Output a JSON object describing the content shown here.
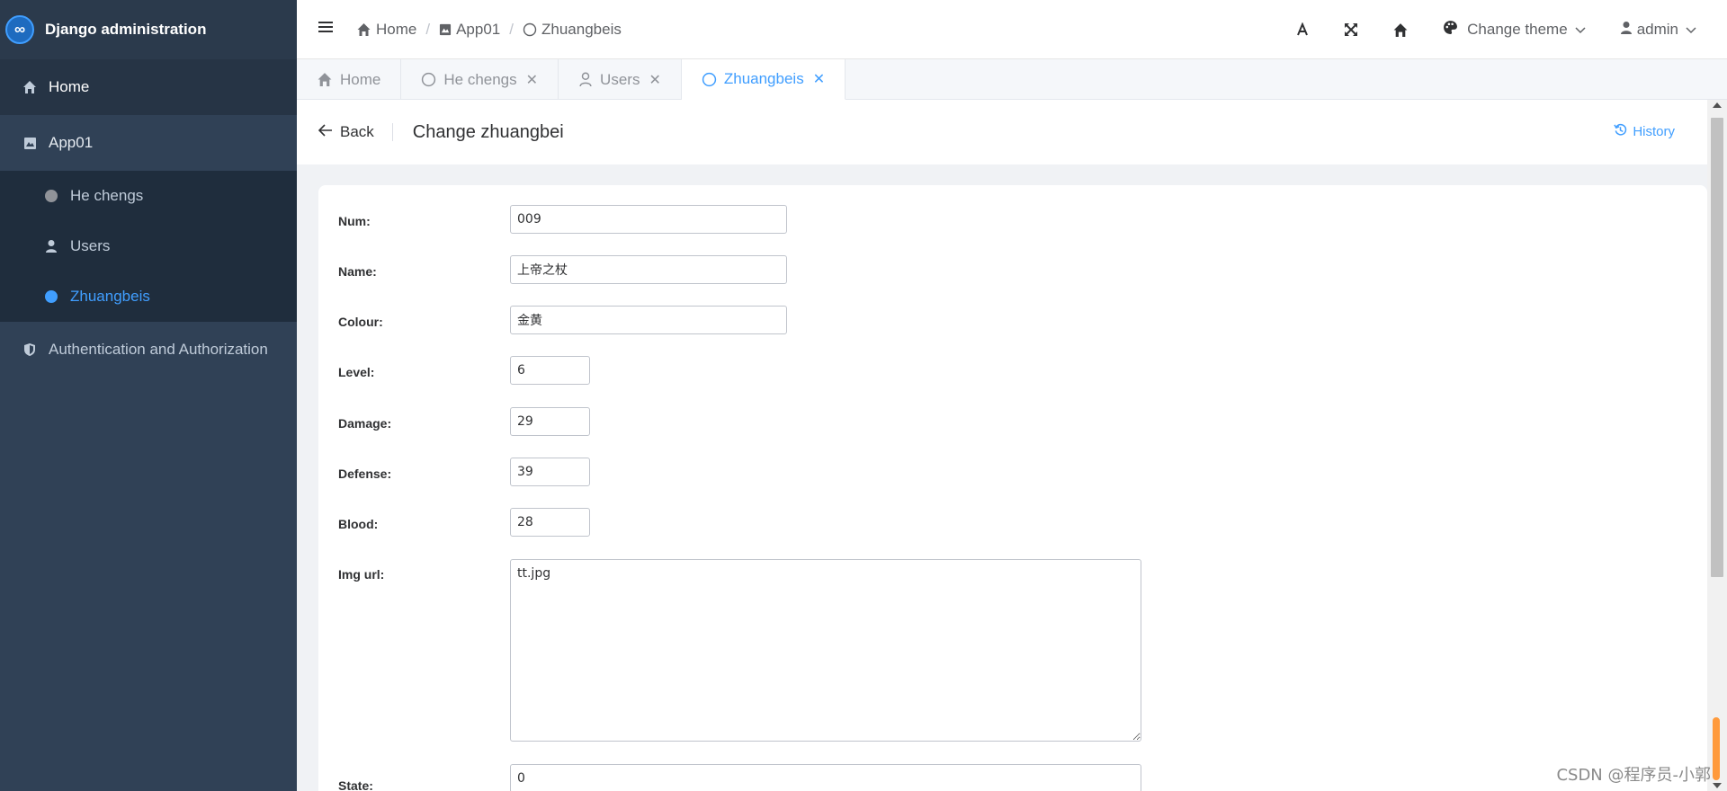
{
  "brand": {
    "title": "Django administration",
    "logo_glyph": "∞"
  },
  "sidebar": {
    "home": "Home",
    "app": "App01",
    "items": [
      {
        "label": "He chengs"
      },
      {
        "label": "Users"
      },
      {
        "label": "Zhuangbeis"
      }
    ],
    "auth": "Authentication and Authorization"
  },
  "header": {
    "breadcrumb": {
      "home": "Home",
      "app": "App01",
      "current": "Zhuangbeis"
    },
    "change_theme": "Change theme",
    "user": "admin"
  },
  "tabs": [
    {
      "label": "Home"
    },
    {
      "label": "He chengs"
    },
    {
      "label": "Users"
    },
    {
      "label": "Zhuangbeis"
    }
  ],
  "page": {
    "back": "Back",
    "title": "Change zhuangbei",
    "history": "History"
  },
  "form": {
    "num": {
      "label": "Num:",
      "value": "009"
    },
    "name": {
      "label": "Name:",
      "value": "上帝之杖"
    },
    "colour": {
      "label": "Colour:",
      "value": "金黄"
    },
    "level": {
      "label": "Level:",
      "value": "6"
    },
    "damage": {
      "label": "Damage:",
      "value": "29"
    },
    "defense": {
      "label": "Defense:",
      "value": "39"
    },
    "blood": {
      "label": "Blood:",
      "value": "28"
    },
    "img_url": {
      "label": "Img url:",
      "value": "tt.jpg"
    },
    "state": {
      "label": "State:",
      "value": "0"
    }
  },
  "watermark": "CSDN @程序员-小郭",
  "colors": {
    "sidebar": "#304156",
    "accent": "#409eff"
  }
}
